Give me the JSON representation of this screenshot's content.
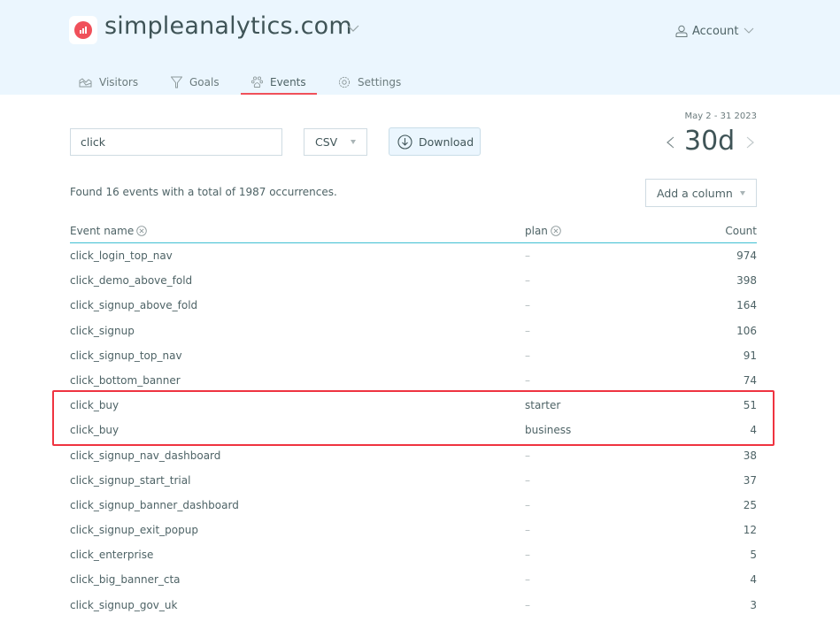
{
  "header": {
    "site_name": "simpleanalytics.com",
    "logo_icon": "bar-chart-icon",
    "brand_color": "#f0505a",
    "account_label": "Account"
  },
  "nav": {
    "tabs": [
      {
        "label": "Visitors",
        "icon": "visitors-chart-icon",
        "active": false
      },
      {
        "label": "Goals",
        "icon": "funnel-icon",
        "active": false
      },
      {
        "label": "Events",
        "icon": "paw-icon",
        "active": true
      },
      {
        "label": "Settings",
        "icon": "gear-icon",
        "active": false
      }
    ]
  },
  "toolbar": {
    "search_value": "click",
    "format_selected": "CSV",
    "download_label": "Download"
  },
  "period": {
    "date_range": "May 2 - 31 2023",
    "label": "30d"
  },
  "summary": {
    "text": "Found 16 events with a total of 1987 occurrences.",
    "add_column_label": "Add a column"
  },
  "table": {
    "columns": [
      {
        "label": "Event name",
        "removable": true
      },
      {
        "label": "plan",
        "removable": true
      },
      {
        "label": "Count",
        "removable": false
      }
    ],
    "rows": [
      {
        "name": "click_login_top_nav",
        "plan": "–",
        "count": "974"
      },
      {
        "name": "click_demo_above_fold",
        "plan": "–",
        "count": "398"
      },
      {
        "name": "click_signup_above_fold",
        "plan": "–",
        "count": "164"
      },
      {
        "name": "click_signup",
        "plan": "–",
        "count": "106"
      },
      {
        "name": "click_signup_top_nav",
        "plan": "–",
        "count": "91"
      },
      {
        "name": "click_bottom_banner",
        "plan": "–",
        "count": "74"
      },
      {
        "name": "click_buy",
        "plan": "starter",
        "count": "51"
      },
      {
        "name": "click_buy",
        "plan": "business",
        "count": "4"
      },
      {
        "name": "click_signup_nav_dashboard",
        "plan": "–",
        "count": "38"
      },
      {
        "name": "click_signup_start_trial",
        "plan": "–",
        "count": "37"
      },
      {
        "name": "click_signup_banner_dashboard",
        "plan": "–",
        "count": "25"
      },
      {
        "name": "click_signup_exit_popup",
        "plan": "–",
        "count": "12"
      },
      {
        "name": "click_enterprise",
        "plan": "–",
        "count": "5"
      },
      {
        "name": "click_big_banner_cta",
        "plan": "–",
        "count": "4"
      },
      {
        "name": "click_signup_gov_uk",
        "plan": "–",
        "count": "3"
      }
    ]
  },
  "annotation": {
    "highlight_color": "#ef3340",
    "highlighted_rows": [
      "click_buy / starter",
      "click_buy / business"
    ]
  }
}
